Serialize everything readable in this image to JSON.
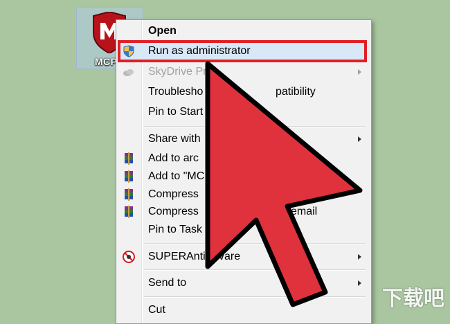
{
  "desktop_icon": {
    "label": "MCPR"
  },
  "menu": {
    "items": [
      {
        "label": "Open",
        "bold": true
      },
      {
        "label": "Run as administrator",
        "icon": "uac-shield-icon"
      },
      {
        "label": "SkyDrive Pr",
        "disabled": true,
        "icon": "skydrive-cloud-icon",
        "submenu": true
      },
      {
        "label": "Troublesho",
        "label2": "patibility"
      },
      {
        "label": "Pin to Start"
      },
      {
        "label": "Share with",
        "submenu": true
      },
      {
        "label": "Add to arc",
        "icon": "winrar-icon"
      },
      {
        "label": "Add to \"MC",
        "icon": "winrar-icon"
      },
      {
        "label": "Compress",
        "icon": "winrar-icon"
      },
      {
        "label": "Compress",
        "label2": "email",
        "icon": "winrar-icon"
      },
      {
        "label": "Pin to Task"
      },
      {
        "label": "SUPERAnti",
        "label2": "vare",
        "icon": "superantispyware-icon",
        "submenu": true
      },
      {
        "label": "Send to",
        "submenu": true
      },
      {
        "label": "Cut"
      }
    ]
  },
  "watermark": "下载吧",
  "colors": {
    "highlight_box": "#e21f26",
    "pointer_fill": "#e0323c"
  }
}
